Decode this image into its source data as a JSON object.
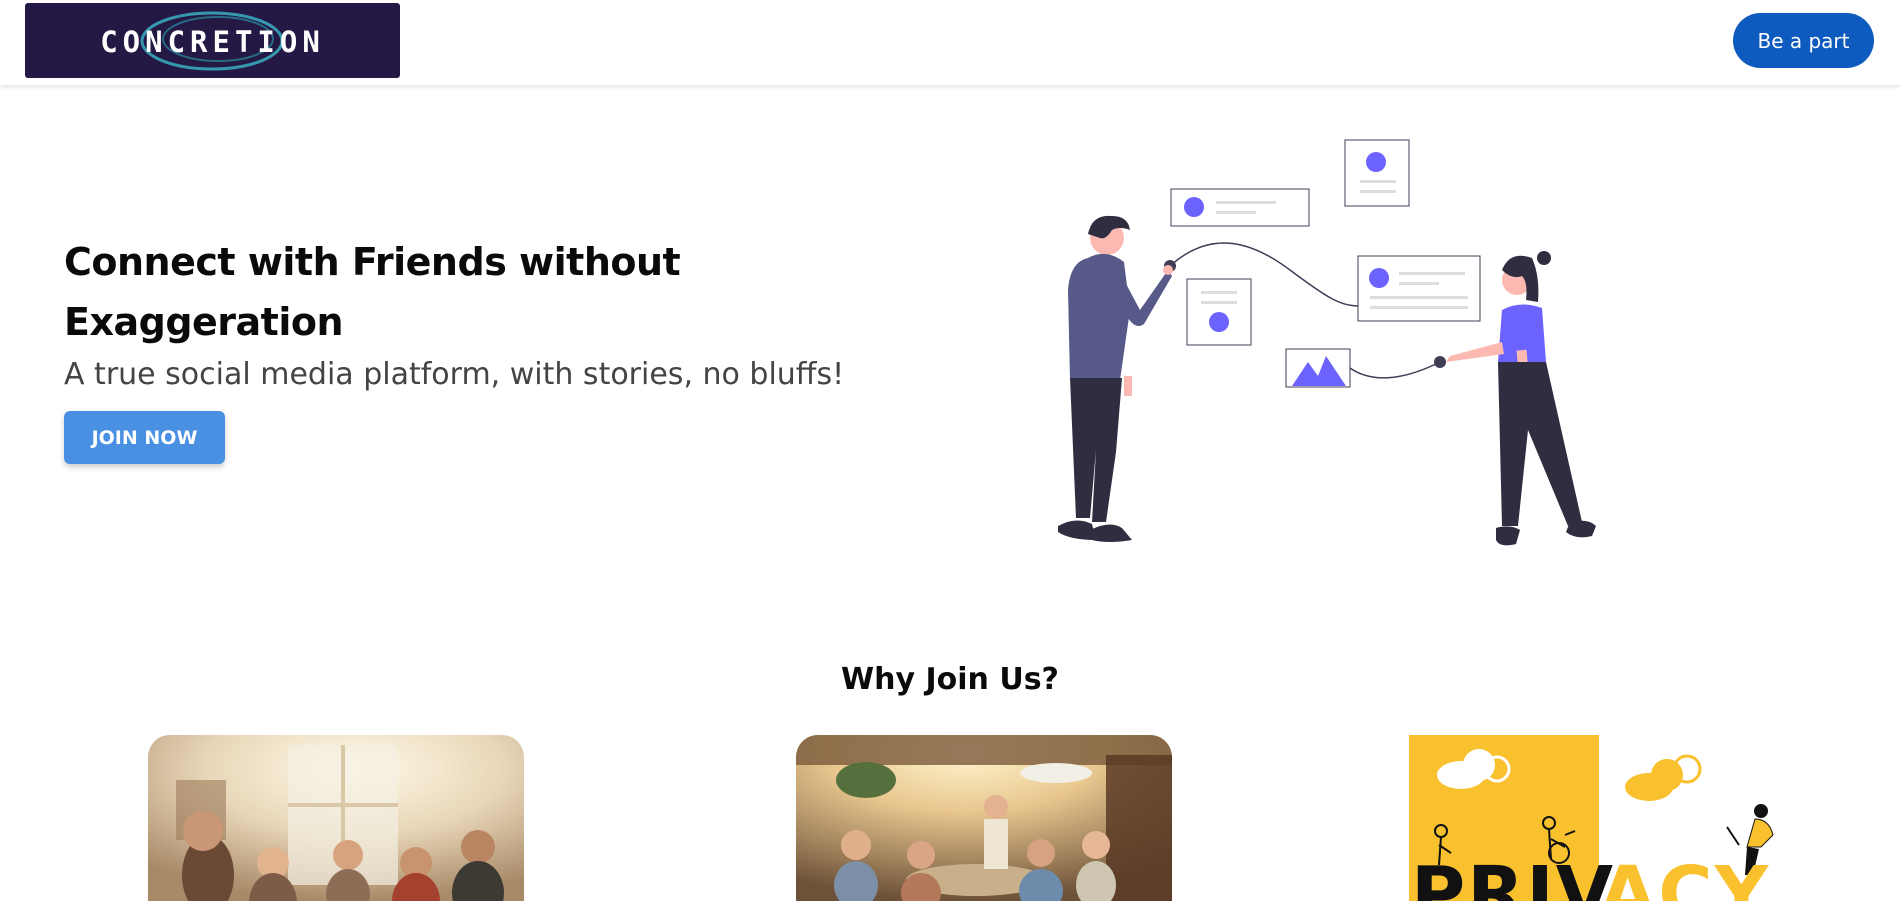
{
  "header": {
    "logo_text": "CONCRETION",
    "cta_label": "Be a part"
  },
  "hero": {
    "title": "Connect with Friends without Exaggeration",
    "subtitle": "A true social media platform, with stories, no bluffs!",
    "join_label": "JOIN NOW"
  },
  "why": {
    "title": "Why Join Us?"
  },
  "cards": [
    {
      "image": "friends-gathering-photo"
    },
    {
      "image": "seniors-outdoor-gathering-photo"
    },
    {
      "image": "privacy-illustration",
      "partial_text": "PRIVACY"
    }
  ],
  "colors": {
    "brand_blue": "#0d5bbf",
    "button_blue": "#4a90e2",
    "accent_purple": "#6c63ff",
    "privacy_yellow": "#f9c12e",
    "logo_bg": "#241845"
  }
}
